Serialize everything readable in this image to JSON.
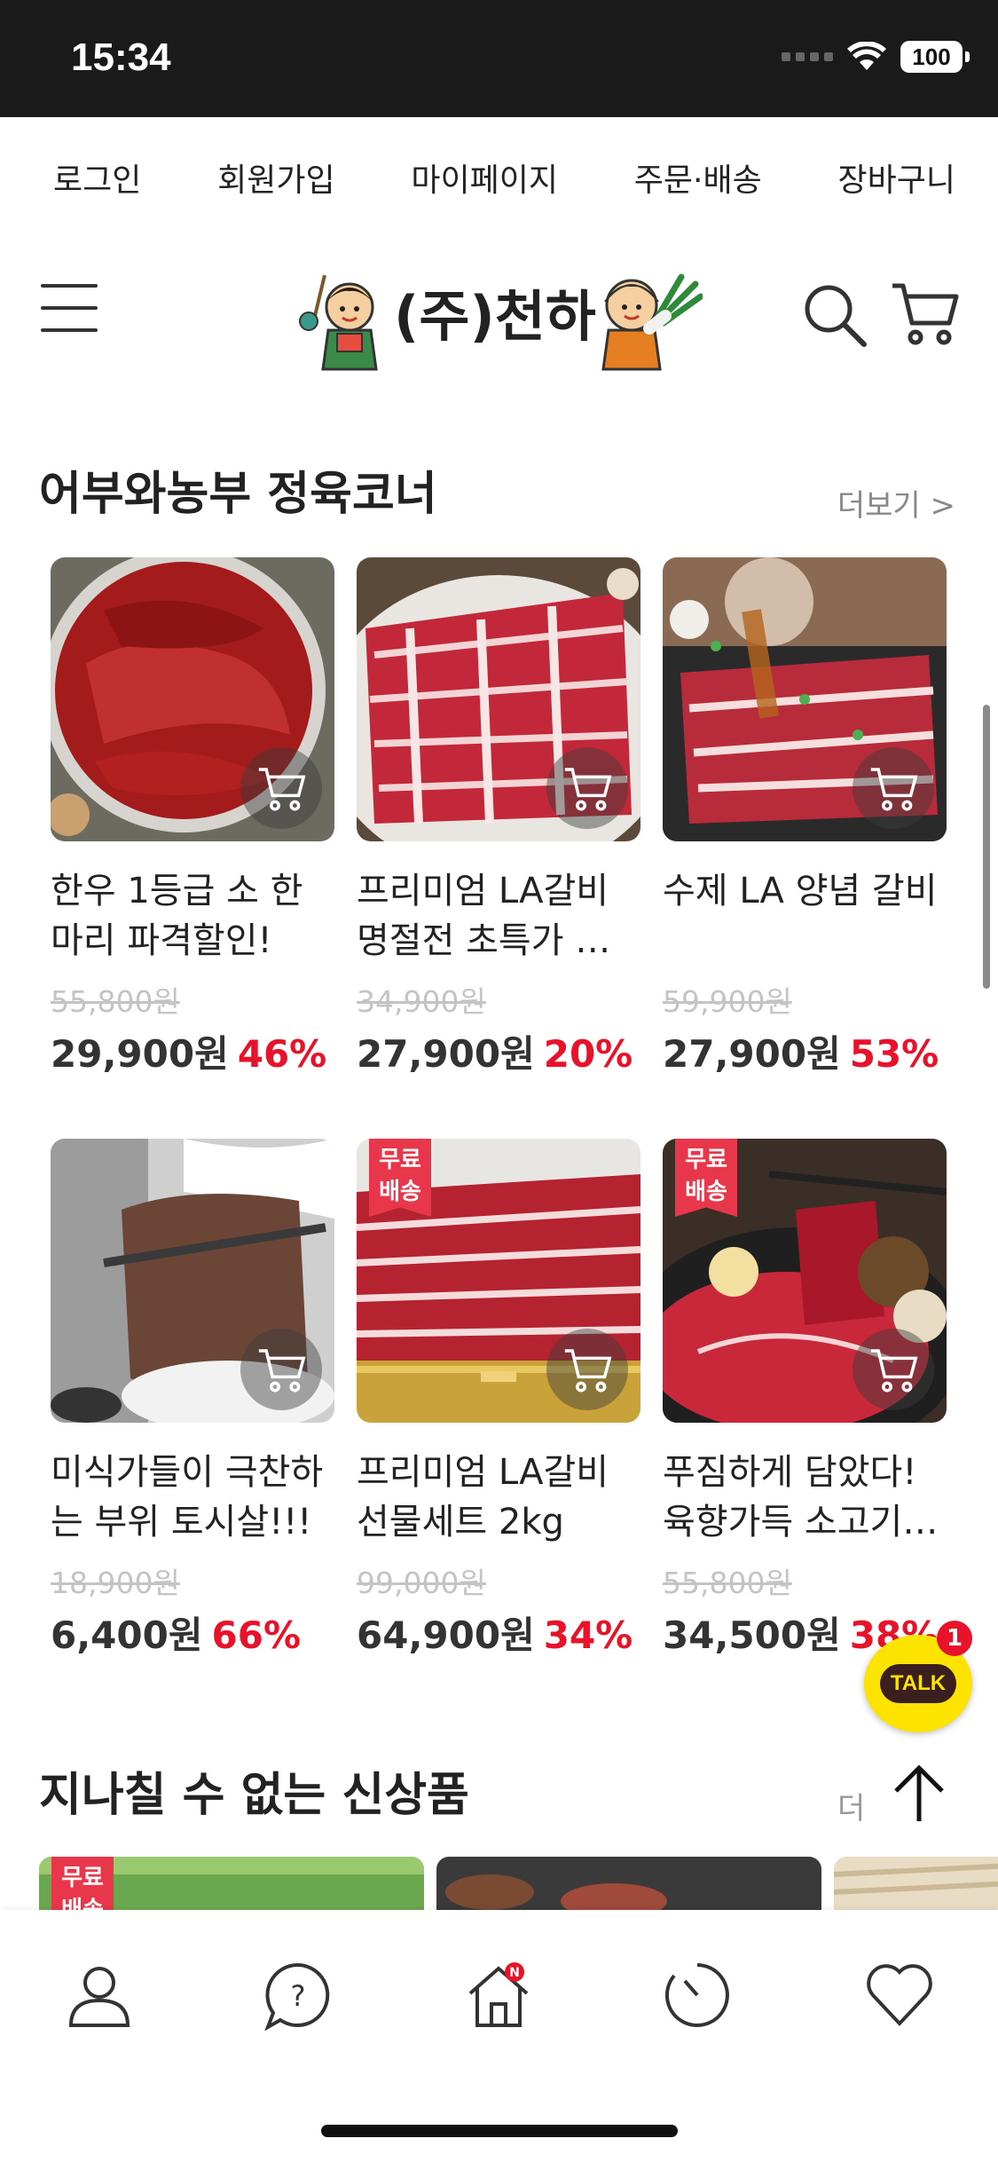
{
  "status_bar": {
    "time": "15:34",
    "battery": "100"
  },
  "top_nav": [
    "로그인",
    "회원가입",
    "마이페이지",
    "주문·배송",
    "장바구니"
  ],
  "header": {
    "logo_text": "(주)천하"
  },
  "section1": {
    "title": "어부와농부 정육코너",
    "more": "더보기 >",
    "products": [
      {
        "name": "한우 1등급 소 한마리 파격할인!",
        "original_price": "55,800원",
        "price": "29,900원",
        "discount": "46%",
        "free_shipping": false
      },
      {
        "name": "프리미엄 LA갈비 명절전 초특가 …",
        "original_price": "34,900원",
        "price": "27,900원",
        "discount": "20%",
        "free_shipping": false
      },
      {
        "name": "수제 LA 양념 갈비",
        "original_price": "59,900원",
        "price": "27,900원",
        "discount": "53%",
        "free_shipping": false
      },
      {
        "name": "미식가들이 극찬하는 부위 토시살!!!",
        "original_price": "18,900원",
        "price": "6,400원",
        "discount": "66%",
        "free_shipping": false
      },
      {
        "name": "프리미엄 LA갈비 선물세트 2kg",
        "original_price": "99,000원",
        "price": "64,900원",
        "discount": "34%",
        "free_shipping": true
      },
      {
        "name": "푸짐하게 담았다! 육향가득 소고기…",
        "original_price": "55,800원",
        "price": "34,500원",
        "discount": "38%",
        "free_shipping": true
      }
    ],
    "free_badge_label": "무료배송"
  },
  "section2": {
    "title": "지나칠 수 없는 신상품",
    "more": "더"
  },
  "kakao": {
    "label": "TALK",
    "count": "1"
  },
  "bottom_tabs": [
    "user-icon",
    "question-icon",
    "home-icon",
    "history-icon",
    "heart-icon"
  ],
  "home_badge": "N",
  "colors": {
    "discount": "#e8132a",
    "free_badge": "#e8364a",
    "kakao": "#fce300"
  }
}
